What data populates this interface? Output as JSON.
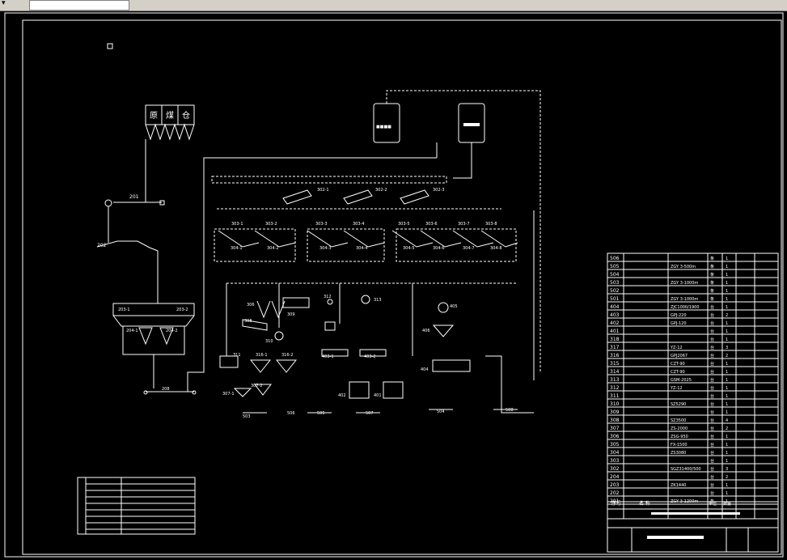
{
  "diagram": {
    "hopper_chars": [
      "原",
      "煤",
      "仓"
    ],
    "equipment_labels": {
      "l201": "201",
      "l202": "202",
      "l203a": "203-1",
      "l203b": "203-2",
      "l204a": "204-1",
      "l204b": "204-2",
      "l208": "208",
      "l302a": "302-1",
      "l302b": "302-2",
      "l302c": "302-3",
      "l303a": "303-1",
      "l303b": "303-2",
      "l303c": "303-3",
      "l303d": "303-4",
      "l303e": "303-5",
      "l303f": "303-6",
      "l303g": "303-7",
      "l303h": "303-8",
      "l304a": "304-1",
      "l304b": "304-2",
      "l304c": "304-3",
      "l304d": "304-4",
      "l304e": "304-5",
      "l304f": "304-6",
      "l304g": "304-7",
      "l304h": "304-8",
      "l306": "306",
      "l307a": "307-1",
      "l307b": "307-2",
      "l308": "308",
      "l309": "309",
      "l310": "310",
      "l311": "311",
      "l312": "312",
      "l313": "313",
      "l316a": "316-1",
      "l316b": "316-2",
      "l401": "401",
      "l402": "402",
      "l403a": "403-1",
      "l403b": "403-2",
      "l404": "404",
      "l405": "405",
      "l406": "406",
      "l503": "503",
      "l504": "504",
      "l505": "505",
      "l506": "506",
      "l507": "507",
      "l508": "508",
      "l509": "509"
    }
  },
  "equipment_table": {
    "rows": [
      {
        "no": "506",
        "spec": "",
        "unit": "条",
        "qty": "1"
      },
      {
        "no": "505",
        "spec": "ZGY 3-500m",
        "unit": "条",
        "qty": "1"
      },
      {
        "no": "504",
        "spec": "",
        "unit": "条",
        "qty": "1"
      },
      {
        "no": "503",
        "spec": "ZGY 3-1000m",
        "unit": "条",
        "qty": "1"
      },
      {
        "no": "502",
        "spec": "",
        "unit": "条",
        "qty": "1"
      },
      {
        "no": "501",
        "spec": "ZGY 3-1000m",
        "unit": "条",
        "qty": "1"
      },
      {
        "no": "404",
        "spec": "ZJC1000/1900",
        "unit": "台",
        "qty": "1"
      },
      {
        "no": "403",
        "spec": "GPJ-220",
        "unit": "台",
        "qty": "2"
      },
      {
        "no": "402",
        "spec": "GPJ-120",
        "unit": "台",
        "qty": "1"
      },
      {
        "no": "401",
        "spec": "",
        "unit": "台",
        "qty": "1"
      },
      {
        "no": "318",
        "spec": "",
        "unit": "台",
        "qty": "1"
      },
      {
        "no": "317",
        "spec": "YZ-12",
        "unit": "台",
        "qty": "3"
      },
      {
        "no": "316",
        "spec": "GPJ2067",
        "unit": "台",
        "qty": "2"
      },
      {
        "no": "315",
        "spec": "CZT-90",
        "unit": "台",
        "qty": "1"
      },
      {
        "no": "314",
        "spec": "CZT-90",
        "unit": "台",
        "qty": "1"
      },
      {
        "no": "313",
        "spec": "GSM-2025",
        "unit": "台",
        "qty": "1"
      },
      {
        "no": "312",
        "spec": "YZ-12",
        "unit": "台",
        "qty": "1"
      },
      {
        "no": "311",
        "spec": "",
        "unit": "台",
        "qty": "1"
      },
      {
        "no": "310",
        "spec": "SZ5290",
        "unit": "台",
        "qty": "1"
      },
      {
        "no": "309",
        "spec": "",
        "unit": "台",
        "qty": "1"
      },
      {
        "no": "308",
        "spec": "SZ3500",
        "unit": "台",
        "qty": "4"
      },
      {
        "no": "307",
        "spec": "ZS-2000",
        "unit": "台",
        "qty": "2"
      },
      {
        "no": "306",
        "spec": "ZSG-950",
        "unit": "台",
        "qty": "1"
      },
      {
        "no": "305",
        "spec": "FX-1500",
        "unit": "台",
        "qty": "1"
      },
      {
        "no": "304",
        "spec": "ZS3080",
        "unit": "台",
        "qty": "1"
      },
      {
        "no": "303",
        "spec": "",
        "unit": "台",
        "qty": "1"
      },
      {
        "no": "302",
        "spec": "SGZ31400/500",
        "unit": "台",
        "qty": "3"
      },
      {
        "no": "204",
        "spec": "",
        "unit": "台",
        "qty": "2"
      },
      {
        "no": "203",
        "spec": "ZK1440",
        "unit": "台",
        "qty": "1"
      },
      {
        "no": "202",
        "spec": "",
        "unit": "台",
        "qty": "1"
      },
      {
        "no": "201",
        "spec": "ZGY 3-1200m",
        "unit": "条",
        "qty": "1"
      }
    ],
    "header": {
      "no": "序号",
      "name": "名  称",
      "unit": "单位",
      "qty": "数量"
    }
  },
  "colors": {
    "background": "#000000",
    "line": "#ffffff",
    "chrome": "#d4d0c8"
  }
}
